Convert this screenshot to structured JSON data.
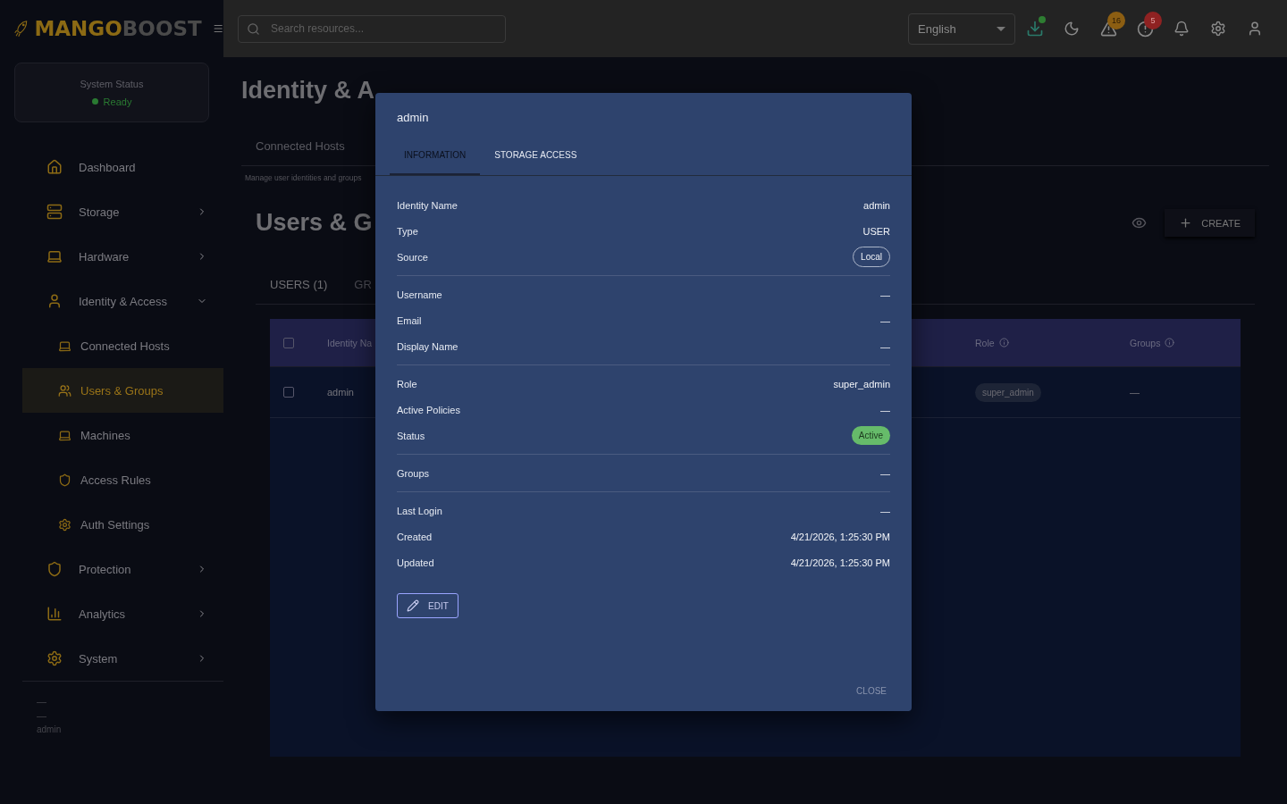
{
  "brand": {
    "part_1": "MANGO",
    "part_2": "BOOST"
  },
  "status_card": {
    "title": "System Status",
    "status": "Ready"
  },
  "sidebar": {
    "items": [
      {
        "label": "Dashboard",
        "selected": false
      },
      {
        "label": "Storage",
        "selected": false,
        "expanded": false
      },
      {
        "label": "Hardware",
        "selected": false,
        "expanded": false
      },
      {
        "label": "Identity & Access",
        "selected": false,
        "expanded": true,
        "children": [
          {
            "label": "Connected Hosts",
            "selected": false
          },
          {
            "label": "Users & Groups",
            "selected": true
          },
          {
            "label": "Machines",
            "selected": false
          },
          {
            "label": "Access Rules",
            "selected": false
          },
          {
            "label": "Auth Settings",
            "selected": false
          }
        ]
      },
      {
        "label": "Protection",
        "selected": false,
        "expanded": false
      },
      {
        "label": "Analytics",
        "selected": false,
        "expanded": false
      },
      {
        "label": "System",
        "selected": false,
        "expanded": false
      }
    ],
    "footer": [
      "—",
      "—",
      "admin"
    ]
  },
  "topbar": {
    "search": {
      "placeholder": "Search resources..."
    },
    "language": "English",
    "alerts_badge": "16",
    "errors_badge": "5"
  },
  "page": {
    "title": "Identity & A",
    "tabs": [
      {
        "label": "Connected Hosts",
        "selected": false
      }
    ],
    "description": "Manage user identities and groups",
    "section_title": "Users & G",
    "create_button": "CREATE",
    "subtabs": [
      {
        "label": "USERS (1)",
        "selected": true
      },
      {
        "label": "GR",
        "selected": false
      }
    ],
    "table": {
      "select_all_checked": false,
      "columns": [
        "Identity Na",
        "Role",
        "Groups"
      ],
      "rows": [
        {
          "checked": false,
          "name": "admin",
          "role": "super_admin",
          "groups": "—"
        }
      ]
    }
  },
  "dialog": {
    "title": "admin",
    "tabs": [
      {
        "label": "INFORMATION",
        "selected": true
      },
      {
        "label": "STORAGE ACCESS",
        "selected": false
      }
    ],
    "sections": [
      [
        {
          "label": "Identity Name",
          "value": "admin",
          "kind": "text"
        },
        {
          "label": "Type",
          "value": "USER",
          "kind": "text"
        },
        {
          "label": "Source",
          "value": "Local",
          "kind": "chip"
        }
      ],
      [
        {
          "label": "Username",
          "value": "—",
          "kind": "text"
        },
        {
          "label": "Email",
          "value": "—",
          "kind": "text"
        },
        {
          "label": "Display Name",
          "value": "—",
          "kind": "text"
        }
      ],
      [
        {
          "label": "Role",
          "value": "super_admin",
          "kind": "text"
        },
        {
          "label": "Active Policies",
          "value": "—",
          "kind": "text"
        },
        {
          "label": "Status",
          "value": "Active",
          "kind": "status"
        }
      ],
      [
        {
          "label": "Groups",
          "value": "—",
          "kind": "text"
        }
      ],
      [
        {
          "label": "Last Login",
          "value": "—",
          "kind": "text"
        },
        {
          "label": "Created",
          "value": "4/21/2026, 1:25:30 PM",
          "kind": "text"
        },
        {
          "label": "Updated",
          "value": "4/21/2026, 1:25:30 PM",
          "kind": "text"
        }
      ]
    ],
    "edit_button": "EDIT",
    "close_button": "CLOSE"
  }
}
